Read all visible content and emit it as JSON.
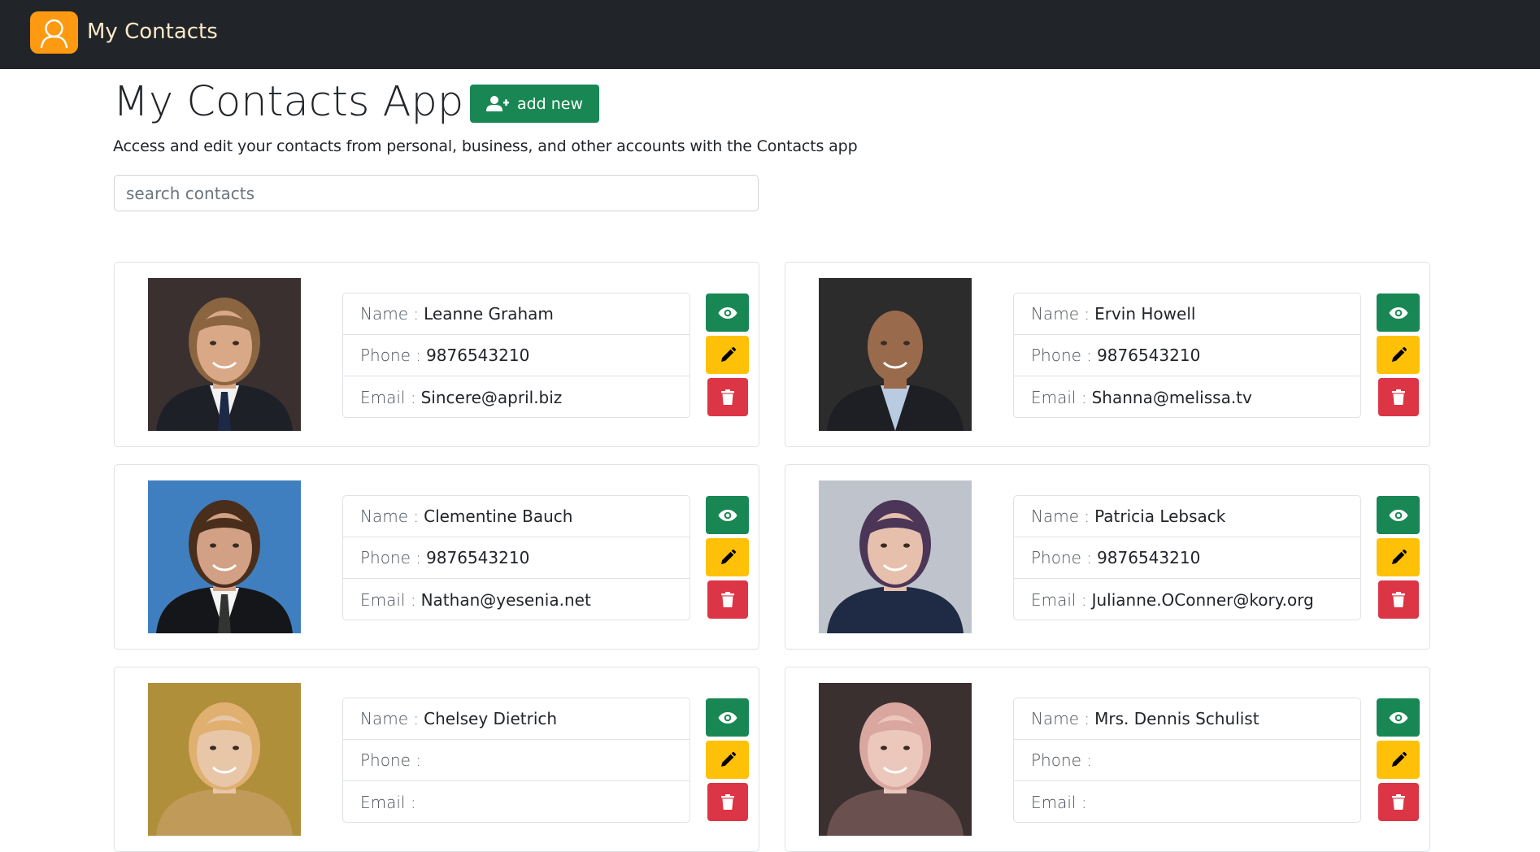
{
  "brand": {
    "name": "My Contacts",
    "logo_icon": "user-outline-icon",
    "logo_color": "#fd9a12"
  },
  "page": {
    "title": "My Contacts App",
    "add_label": "add new",
    "subtitle": "Access and edit your contacts from personal, business, and other accounts with the Contacts app",
    "search_placeholder": "search contacts"
  },
  "labels": {
    "name": "Name :",
    "phone": "Phone :",
    "email": "Email :"
  },
  "colors": {
    "view": "#198754",
    "edit": "#ffc107",
    "delete": "#dc3545",
    "navbar": "#212529"
  },
  "contacts": [
    {
      "name": "Leanne Graham",
      "phone": "9876543210",
      "email": "Sincere@april.biz"
    },
    {
      "name": "Ervin Howell",
      "phone": "9876543210",
      "email": "Shanna@melissa.tv"
    },
    {
      "name": "Clementine Bauch",
      "phone": "9876543210",
      "email": "Nathan@yesenia.net"
    },
    {
      "name": "Patricia Lebsack",
      "phone": "9876543210",
      "email": "Julianne.OConner@kory.org"
    },
    {
      "name": "Chelsey Dietrich"
    },
    {
      "name": "Mrs. Dennis Schulist"
    }
  ]
}
